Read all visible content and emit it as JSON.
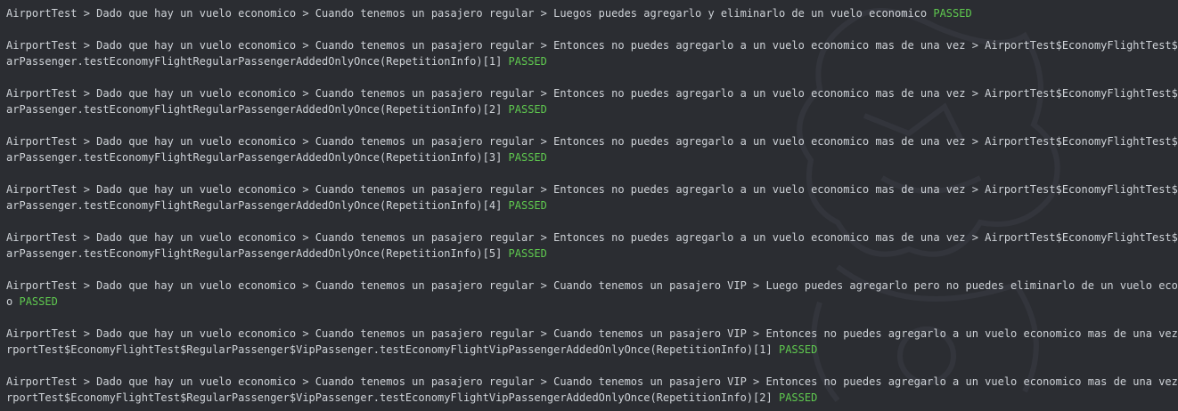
{
  "console": {
    "lines": [
      {
        "text": "AirportTest > Dado que hay un vuelo economico > Cuando tenemos un pasajero regular > Luegos puedes agregarlo y eliminarlo de un vuelo economico",
        "cont": "",
        "status": "PASSED"
      },
      {
        "text": "AirportTest > Dado que hay un vuelo economico > Cuando tenemos un pasajero regular > Entonces no puedes agregarlo a un vuelo economico mas de una vez > AirportTest$EconomyFlightTest$Regul",
        "cont": "arPassenger.testEconomyFlightRegularPassengerAddedOnlyOnce(RepetitionInfo)[1]",
        "status": "PASSED"
      },
      {
        "text": "AirportTest > Dado que hay un vuelo economico > Cuando tenemos un pasajero regular > Entonces no puedes agregarlo a un vuelo economico mas de una vez > AirportTest$EconomyFlightTest$Regul",
        "cont": "arPassenger.testEconomyFlightRegularPassengerAddedOnlyOnce(RepetitionInfo)[2]",
        "status": "PASSED"
      },
      {
        "text": "AirportTest > Dado que hay un vuelo economico > Cuando tenemos un pasajero regular > Entonces no puedes agregarlo a un vuelo economico mas de una vez > AirportTest$EconomyFlightTest$Regul",
        "cont": "arPassenger.testEconomyFlightRegularPassengerAddedOnlyOnce(RepetitionInfo)[3]",
        "status": "PASSED"
      },
      {
        "text": "AirportTest > Dado que hay un vuelo economico > Cuando tenemos un pasajero regular > Entonces no puedes agregarlo a un vuelo economico mas de una vez > AirportTest$EconomyFlightTest$Regul",
        "cont": "arPassenger.testEconomyFlightRegularPassengerAddedOnlyOnce(RepetitionInfo)[4]",
        "status": "PASSED"
      },
      {
        "text": "AirportTest > Dado que hay un vuelo economico > Cuando tenemos un pasajero regular > Entonces no puedes agregarlo a un vuelo economico mas de una vez > AirportTest$EconomyFlightTest$Regul",
        "cont": "arPassenger.testEconomyFlightRegularPassengerAddedOnlyOnce(RepetitionInfo)[5]",
        "status": "PASSED"
      },
      {
        "text": "AirportTest > Dado que hay un vuelo economico > Cuando tenemos un pasajero regular > Cuando tenemos un pasajero VIP > Luego puedes agregarlo pero no puedes eliminarlo de un vuelo economic",
        "cont": "o",
        "status": "PASSED"
      },
      {
        "text": "AirportTest > Dado que hay un vuelo economico > Cuando tenemos un pasajero regular > Cuando tenemos un pasajero VIP > Entonces no puedes agregarlo a un vuelo economico mas de una vez > Ai",
        "cont": "rportTest$EconomyFlightTest$RegularPassenger$VipPassenger.testEconomyFlightVipPassengerAddedOnlyOnce(RepetitionInfo)[1]",
        "status": "PASSED"
      },
      {
        "text": "AirportTest > Dado que hay un vuelo economico > Cuando tenemos un pasajero regular > Cuando tenemos un pasajero VIP > Entonces no puedes agregarlo a un vuelo economico mas de una vez > Ai",
        "cont": "rportTest$EconomyFlightTest$RegularPassenger$VipPassenger.testEconomyFlightVipPassengerAddedOnlyOnce(RepetitionInfo)[2]",
        "status": "PASSED"
      }
    ]
  },
  "colors": {
    "background": "#2b2d32",
    "text": "#cfd3d8",
    "passed": "#5fc94f"
  }
}
